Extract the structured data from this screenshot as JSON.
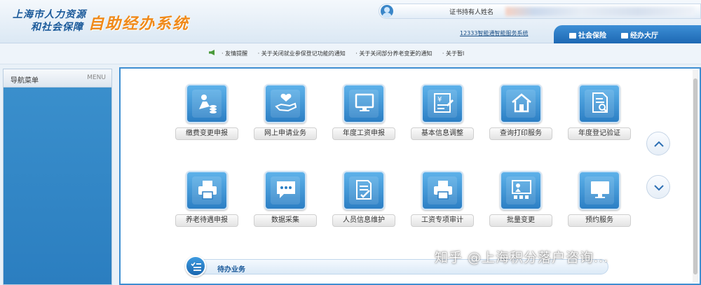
{
  "header": {
    "logo_line1": "上海市人力资源",
    "logo_line2": "和社会保障",
    "system_name": "自助经办系统",
    "user_label": "证书持有人姓名",
    "service_link": "12333智能通智能服务系统",
    "tabs": [
      {
        "label": "社会保险",
        "icon": "social-insurance-icon"
      },
      {
        "label": "经办大厅",
        "icon": "hall-icon"
      }
    ]
  },
  "notice": {
    "items": [
      "· 友情提醒",
      "· 关于关闭就业参保登记功能的通知",
      "· 关于关闭部分养老变更的通知",
      "· 关于暂l"
    ]
  },
  "sidebar": {
    "title": "导航菜单",
    "menu_label": "MENU"
  },
  "services": [
    {
      "label": "缴费变更申报",
      "icon": "payment-change-icon"
    },
    {
      "label": "网上申请业务",
      "icon": "online-apply-icon"
    },
    {
      "label": "年度工资申报",
      "icon": "monitor-icon"
    },
    {
      "label": "基本信息调整",
      "icon": "info-edit-icon"
    },
    {
      "label": "查询打印服务",
      "icon": "house-icon"
    },
    {
      "label": "年度登记验证",
      "icon": "document-search-icon"
    },
    {
      "label": "养老待遇申报",
      "icon": "printer-icon"
    },
    {
      "label": "数据采集",
      "icon": "chat-bubble-icon"
    },
    {
      "label": "人员信息维护",
      "icon": "edit-document-icon"
    },
    {
      "label": "工资专项审计",
      "icon": "printer-icon"
    },
    {
      "label": "批量变更",
      "icon": "presentation-icon"
    },
    {
      "label": "预约服务",
      "icon": "monitor-icon"
    }
  ],
  "todo": {
    "label": "待办业务",
    "icon": "todo-list-icon"
  },
  "watermark": "知乎 @上海积分落户咨询...",
  "colors": {
    "brand_blue": "#1b5a9a",
    "accent_orange": "#f08a1a",
    "sidebar_blue": "#2f84c3",
    "tile_blue": "#2c7fc4"
  }
}
